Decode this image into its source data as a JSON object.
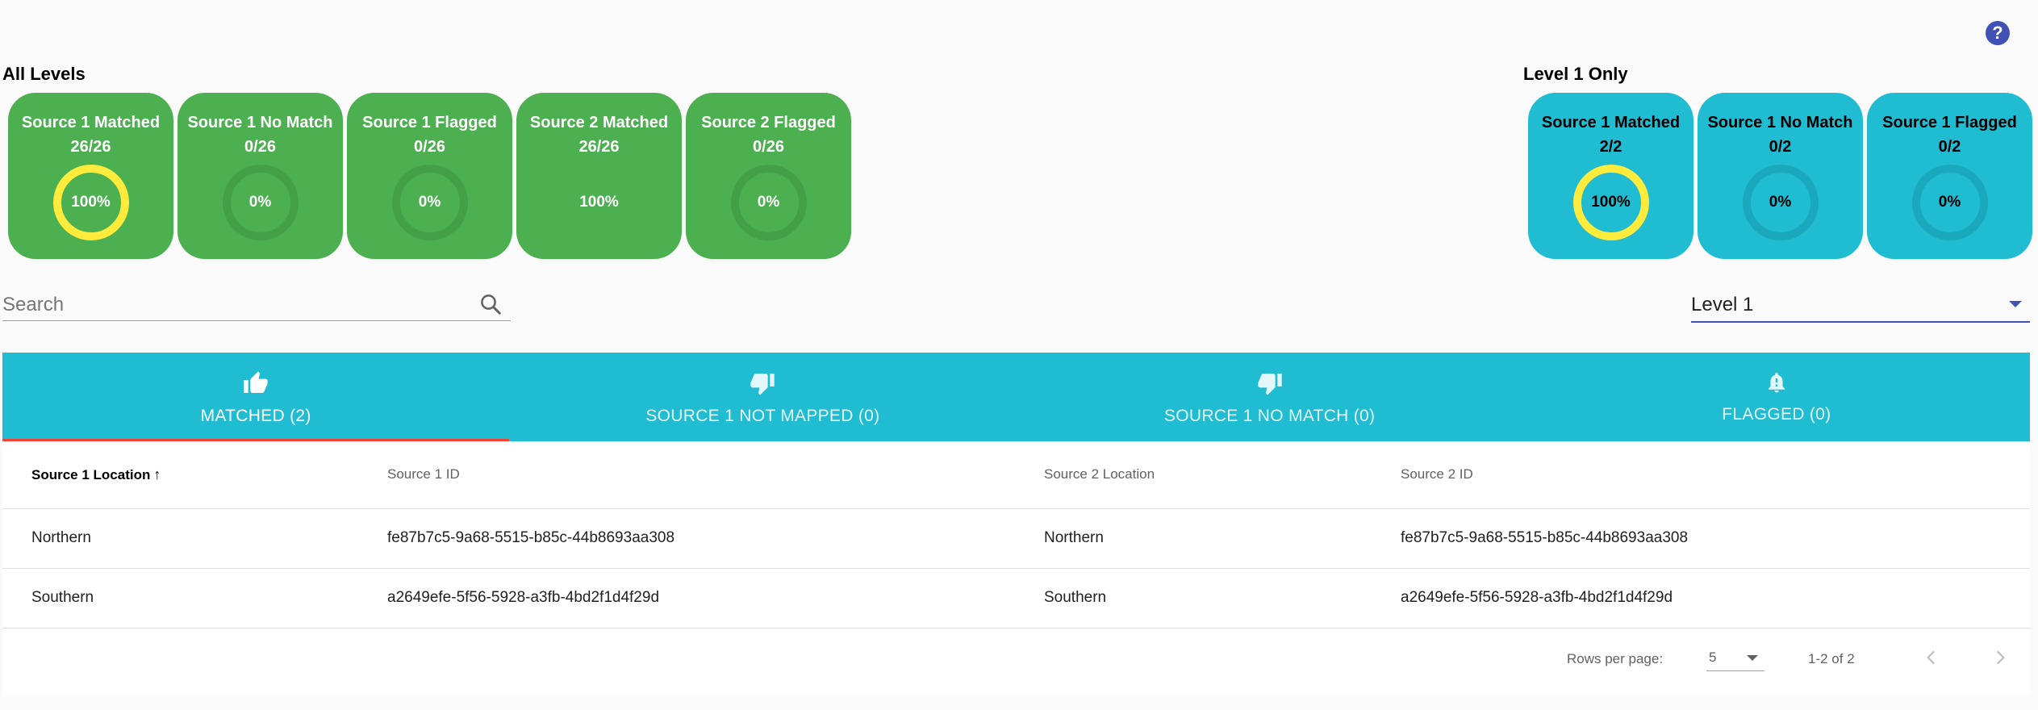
{
  "help_label": "?",
  "all_levels": {
    "title": "All Levels",
    "cards": [
      {
        "title": "Source 1 Matched",
        "count": "26/26",
        "percent_label": "100%",
        "percent": 100
      },
      {
        "title": "Source 1 No Match",
        "count": "0/26",
        "percent_label": "0%",
        "percent": 0
      },
      {
        "title": "Source 1 Flagged",
        "count": "0/26",
        "percent_label": "0%",
        "percent": 0
      },
      {
        "title": "Source 2 Matched",
        "count": "26/26",
        "percent_label": "100%",
        "percent": 100,
        "ring_hidden": true
      },
      {
        "title": "Source 2 Flagged",
        "count": "0/26",
        "percent_label": "0%",
        "percent": 0
      }
    ]
  },
  "level1": {
    "title": "Level 1 Only",
    "cards": [
      {
        "title": "Source 1 Matched",
        "count": "2/2",
        "percent_label": "100%",
        "percent": 100
      },
      {
        "title": "Source 1 No Match",
        "count": "0/2",
        "percent_label": "0%",
        "percent": 0
      },
      {
        "title": "Source 1 Flagged",
        "count": "0/2",
        "percent_label": "0%",
        "percent": 0
      }
    ]
  },
  "colors": {
    "green_card": "#4caf50",
    "cyan_card": "#1fbcd2",
    "ring_fill": "#ffeb3b",
    "ring_track_green": "#43a047",
    "ring_track_cyan": "#1aa8bd",
    "primary": "#3f51b5",
    "tab_indicator": "#f44336"
  },
  "search": {
    "placeholder": "Search",
    "value": ""
  },
  "level_select": {
    "value": "Level 1"
  },
  "tabs": [
    {
      "label": "MATCHED (2)",
      "icon": "thumb-up-icon",
      "active": true
    },
    {
      "label": "SOURCE 1 NOT MAPPED (0)",
      "icon": "thumb-down-icon",
      "active": false
    },
    {
      "label": "SOURCE 1 NO MATCH (0)",
      "icon": "thumb-down-icon",
      "active": false
    },
    {
      "label": "FLAGGED (0)",
      "icon": "bell-alert-icon",
      "active": false
    }
  ],
  "table": {
    "columns": [
      "Source 1 Location",
      "Source 1 ID",
      "Source 2 Location",
      "Source 2 ID"
    ],
    "sort_arrow": "↑",
    "rows": [
      [
        "Northern",
        "fe87b7c5-9a68-5515-b85c-44b8693aa308",
        "Northern",
        "fe87b7c5-9a68-5515-b85c-44b8693aa308"
      ],
      [
        "Southern",
        "a2649efe-5f56-5928-a3fb-4bd2f1d4f29d",
        "Southern",
        "a2649efe-5f56-5928-a3fb-4bd2f1d4f29d"
      ]
    ]
  },
  "pagination": {
    "rows_per_page_label": "Rows per page:",
    "rows_per_page": "5",
    "range": "1-2 of 2"
  }
}
